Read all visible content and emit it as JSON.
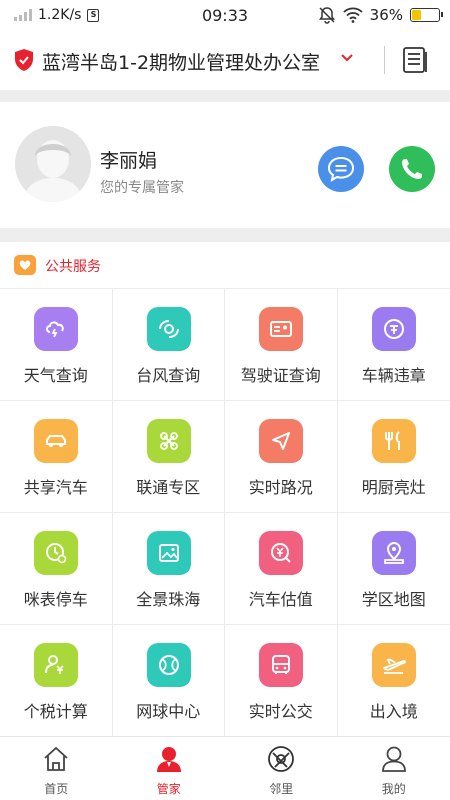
{
  "status_bar": {
    "speed": "1.2K/s",
    "sim": "S",
    "time": "09:33",
    "battery": "36%",
    "battery_level": 0.36
  },
  "header": {
    "title": "蓝湾半岛1-2期物业管理处办公室",
    "shield_color": "#e8212f"
  },
  "manager": {
    "name": "李丽娟",
    "subtitle": "您的专属管家"
  },
  "section": {
    "label": "公共服务"
  },
  "services": [
    {
      "label": "天气查询",
      "icon": "cloud-icon",
      "color": "#a77ff0"
    },
    {
      "label": "台风查询",
      "icon": "typhoon-icon",
      "color": "#2ec9b8"
    },
    {
      "label": "驾驶证查询",
      "icon": "id-card-icon",
      "color": "#f47b65"
    },
    {
      "label": "车辆违章",
      "icon": "violation-icon",
      "color": "#9b7cf0"
    },
    {
      "label": "共享汽车",
      "icon": "car-icon",
      "color": "#f9b54a"
    },
    {
      "label": "联通专区",
      "icon": "unicom-icon",
      "color": "#a9d83b"
    },
    {
      "label": "实时路况",
      "icon": "navigation-icon",
      "color": "#f47b65"
    },
    {
      "label": "明厨亮灶",
      "icon": "kitchen-icon",
      "color": "#f9b54a"
    },
    {
      "label": "咪表停车",
      "icon": "parking-meter-icon",
      "color": "#a9d83b"
    },
    {
      "label": "全景珠海",
      "icon": "panorama-icon",
      "color": "#2ec9b8"
    },
    {
      "label": "汽车估值",
      "icon": "valuation-icon",
      "color": "#f2607f"
    },
    {
      "label": "学区地图",
      "icon": "map-pin-icon",
      "color": "#9b7cf0"
    },
    {
      "label": "个税计算",
      "icon": "tax-icon",
      "color": "#a9d83b"
    },
    {
      "label": "网球中心",
      "icon": "tennis-icon",
      "color": "#2ec9b8"
    },
    {
      "label": "实时公交",
      "icon": "bus-icon",
      "color": "#f2607f"
    },
    {
      "label": "出入境",
      "icon": "plane-icon",
      "color": "#f9b54a"
    }
  ],
  "tabs": [
    {
      "label": "首页",
      "icon": "home-icon",
      "active": false
    },
    {
      "label": "管家",
      "icon": "steward-icon",
      "active": true
    },
    {
      "label": "邻里",
      "icon": "neighbor-icon",
      "active": false
    },
    {
      "label": "我的",
      "icon": "profile-icon",
      "active": false
    }
  ]
}
